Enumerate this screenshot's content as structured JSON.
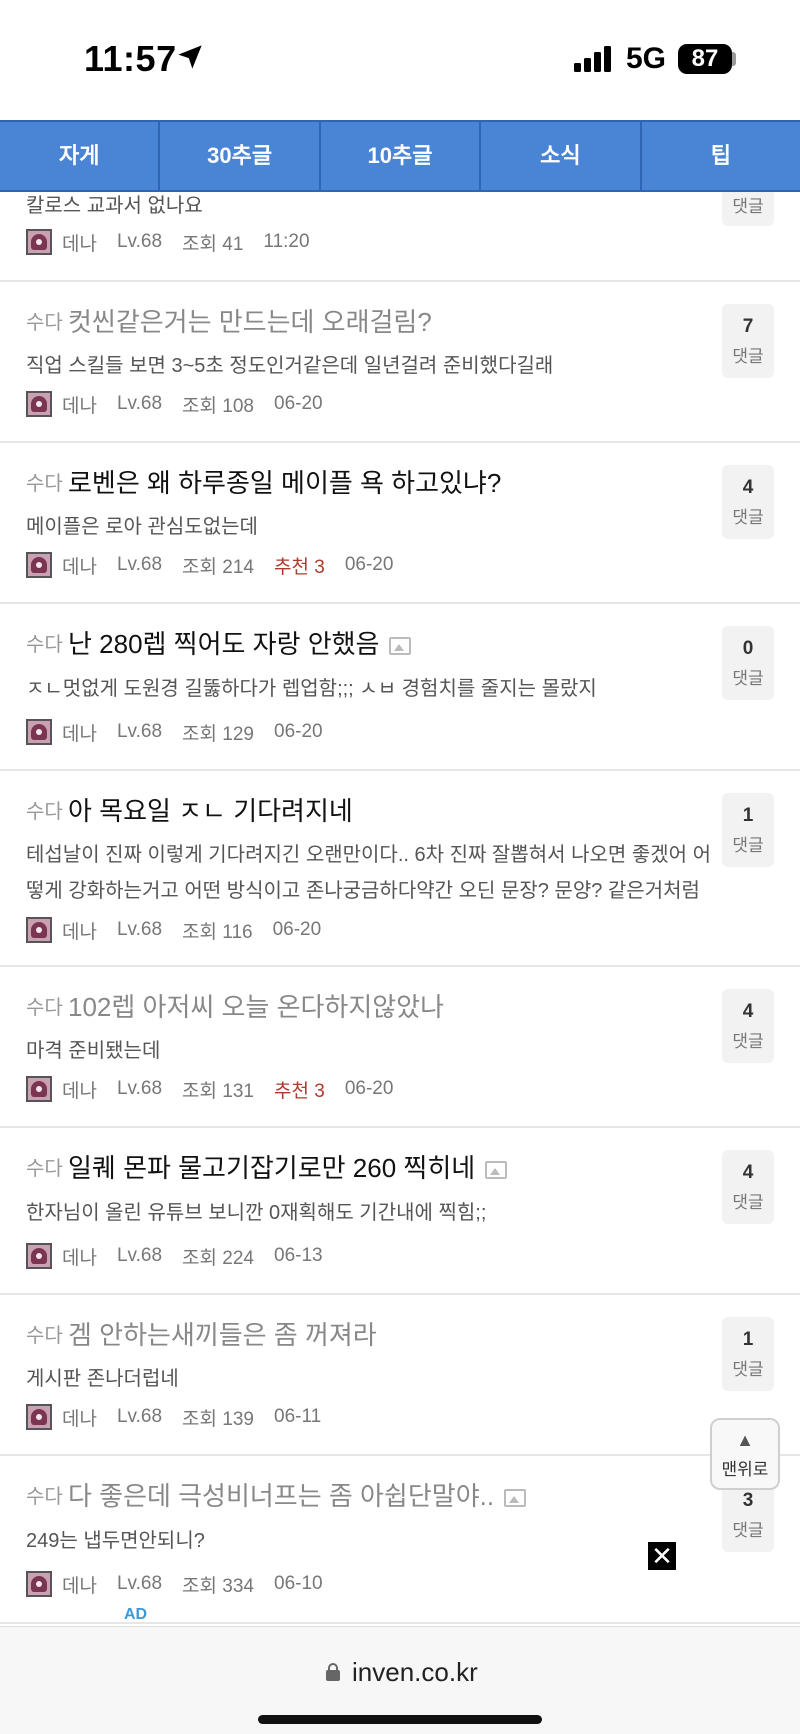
{
  "status": {
    "time": "11:57",
    "network": "5G",
    "battery": "87"
  },
  "tabs": [
    "자게",
    "30추글",
    "10추글",
    "소식",
    "팁"
  ],
  "posts": [
    {
      "category": "",
      "title": "",
      "preview": "칼로스 교과서 없나요",
      "author": "데나",
      "level": "Lv.68",
      "views": "조회 41",
      "recommend": "",
      "date": "11:20",
      "comments_label": "댓글",
      "comments": "",
      "has_image": false,
      "read": false
    },
    {
      "category": "수다",
      "title": "컷씬같은거는 만드는데 오래걸림?",
      "preview": "직업 스킬들 보면 3~5초 정도인거같은데 일년걸려 준비했다길래",
      "author": "데나",
      "level": "Lv.68",
      "views": "조회 108",
      "recommend": "",
      "date": "06-20",
      "comments": "7",
      "comments_label": "댓글",
      "has_image": false,
      "read": true
    },
    {
      "category": "수다",
      "title": "로벤은 왜 하루종일 메이플 욕 하고있냐?",
      "preview": "메이플은 로아 관심도없는데",
      "author": "데나",
      "level": "Lv.68",
      "views": "조회 214",
      "recommend": "추천 3",
      "date": "06-20",
      "comments": "4",
      "comments_label": "댓글",
      "has_image": false,
      "read": false
    },
    {
      "category": "수다",
      "title": "난 280렙 찍어도 자랑 안했음",
      "preview": "ㅈㄴ멋없게 도원경 길뚫하다가 렙업함;;; ㅅㅂ 경험치를 줄지는 몰랐지",
      "author": "데나",
      "level": "Lv.68",
      "views": "조회 129",
      "recommend": "",
      "date": "06-20",
      "comments": "0",
      "comments_label": "댓글",
      "has_image": true,
      "read": false
    },
    {
      "category": "수다",
      "title": "아 목요일 ㅈㄴ 기다려지네",
      "preview": "테섭날이 진짜 이렇게 기다려지긴 오랜만이다.. 6차 진짜 잘뽑혀서 나오면 좋겠어 어떻게 강화하는거고 어떤 방식이고 존나궁금하다약간 오딘 문장? 문양? 같은거처럼 할",
      "author": "데나",
      "level": "Lv.68",
      "views": "조회 116",
      "recommend": "",
      "date": "06-20",
      "comments": "1",
      "comments_label": "댓글",
      "has_image": false,
      "read": false
    },
    {
      "category": "수다",
      "title": "102렙 아저씨 오늘 온다하지않았나",
      "preview": "마격 준비됐는데",
      "author": "데나",
      "level": "Lv.68",
      "views": "조회 131",
      "recommend": "추천 3",
      "date": "06-20",
      "comments": "4",
      "comments_label": "댓글",
      "has_image": false,
      "read": true
    },
    {
      "category": "수다",
      "title": "일퀘 몬파 물고기잡기로만 260 찍히네",
      "preview": "한자님이 올린 유튜브 보니깐 0재획해도 기간내에 찍힘;;",
      "author": "데나",
      "level": "Lv.68",
      "views": "조회 224",
      "recommend": "",
      "date": "06-13",
      "comments": "4",
      "comments_label": "댓글",
      "has_image": true,
      "read": false
    },
    {
      "category": "수다",
      "title": "겜 안하는새끼들은 좀 꺼져라",
      "preview": "게시판 존나더럽네",
      "author": "데나",
      "level": "Lv.68",
      "views": "조회 139",
      "recommend": "",
      "date": "06-11",
      "comments": "1",
      "comments_label": "댓글",
      "has_image": false,
      "read": true
    },
    {
      "category": "수다",
      "title": "다 좋은데 극성비너프는 좀 아쉽단말야..",
      "preview": "249는 냅두면안되니?",
      "author": "데나",
      "level": "Lv.68",
      "views": "조회 334",
      "recommend": "",
      "date": "06-10",
      "comments": "3",
      "comments_label": "댓글",
      "has_image": true,
      "read": true
    }
  ],
  "top_button": {
    "arrow": "▲",
    "label": "맨위로"
  },
  "ad": {
    "label": "AD",
    "close": "✕"
  },
  "browser": {
    "url": "inven.co.kr"
  }
}
